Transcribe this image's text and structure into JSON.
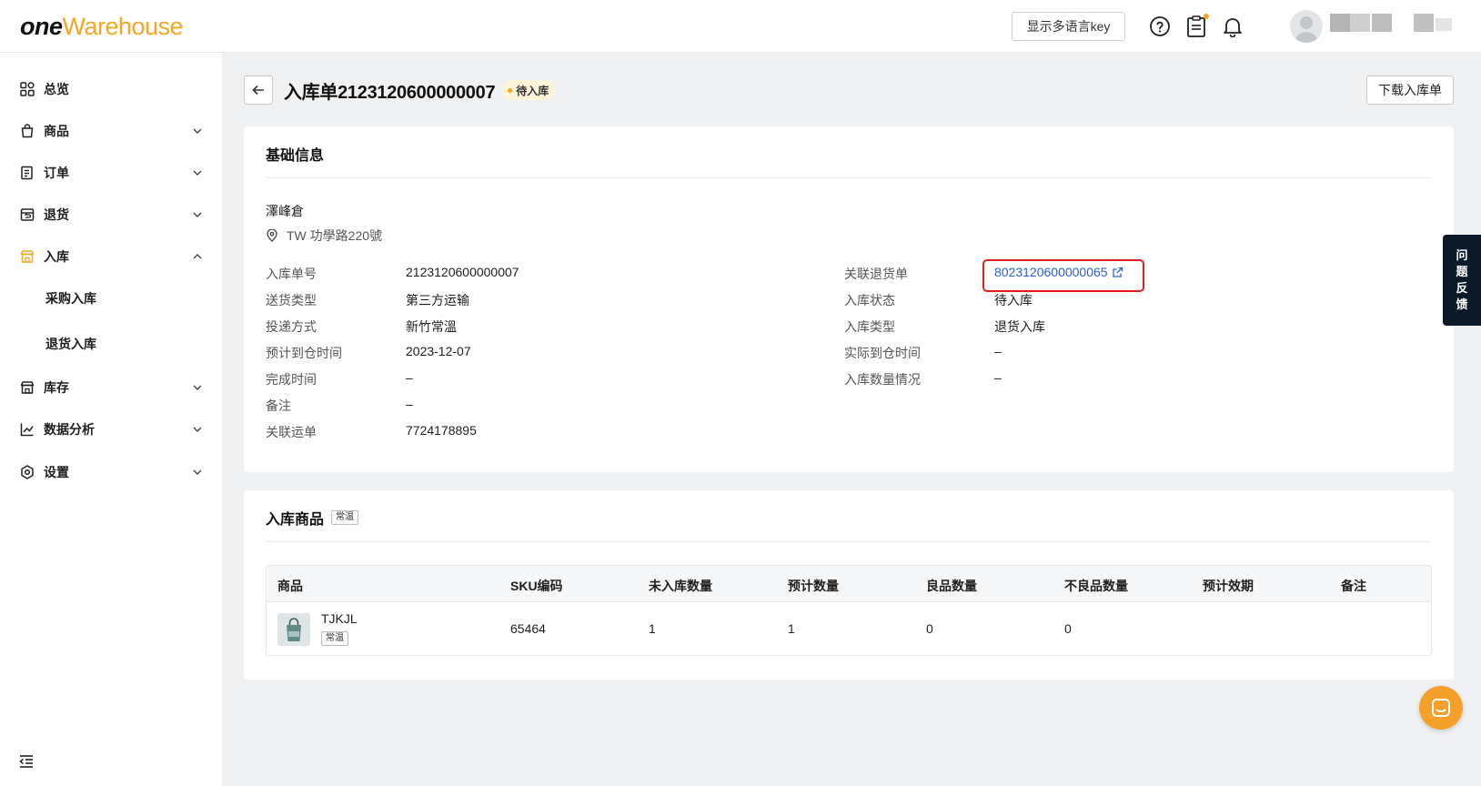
{
  "brand": {
    "part1": "one",
    "part2": "Warehouse"
  },
  "topbar": {
    "lang_button": "显示多语言key",
    "icons": [
      "help-icon",
      "clipboard-icon",
      "bell-icon"
    ]
  },
  "sidebar": {
    "items": [
      {
        "label": "总览",
        "icon": "dashboard-icon",
        "has_chevron": false
      },
      {
        "label": "商品",
        "icon": "bag-icon",
        "has_chevron": true
      },
      {
        "label": "订单",
        "icon": "order-icon",
        "has_chevron": true
      },
      {
        "label": "退货",
        "icon": "return-icon",
        "has_chevron": true
      },
      {
        "label": "入库",
        "icon": "inbound-icon",
        "has_chevron": true,
        "expanded": true
      },
      {
        "label": "库存",
        "icon": "store-icon",
        "has_chevron": true
      },
      {
        "label": "数据分析",
        "icon": "analytics-icon",
        "has_chevron": true
      },
      {
        "label": "设置",
        "icon": "settings-icon",
        "has_chevron": true
      }
    ],
    "sub_items": [
      "采购入库",
      "退货入库"
    ]
  },
  "page": {
    "title": "入库单2123120600000007",
    "status": "待入库",
    "download_button": "下载入库单"
  },
  "basic_info": {
    "title": "基础信息",
    "warehouse_name": "澤峰倉",
    "warehouse_address": "TW 功學路220號",
    "left": [
      {
        "label": "入库单号",
        "value": "2123120600000007"
      },
      {
        "label": "送货类型",
        "value": "第三方运输"
      },
      {
        "label": "投递方式",
        "value": "新竹常溫"
      },
      {
        "label": "预计到仓时间",
        "value": "2023-12-07"
      },
      {
        "label": "完成时间",
        "value": "–"
      },
      {
        "label": "备注",
        "value": "–"
      },
      {
        "label": "关联运单",
        "value": "7724178895"
      }
    ],
    "right": [
      {
        "label": "关联退货单",
        "value": "8023120600000065",
        "is_link": true
      },
      {
        "label": "入库状态",
        "value": "待入库"
      },
      {
        "label": "入库类型",
        "value": "退货入库"
      },
      {
        "label": "实际到仓时间",
        "value": "–"
      },
      {
        "label": "入库数量情况",
        "value": "–"
      }
    ]
  },
  "goods": {
    "title": "入库商品",
    "temp_tag": "常温",
    "columns": [
      "商品",
      "SKU编码",
      "未入库数量",
      "预计数量",
      "良品数量",
      "不良品数量",
      "预计效期",
      "备注"
    ],
    "rows": [
      {
        "name": "TJKJL",
        "tag": "常温",
        "sku": "65464",
        "not_received": "1",
        "expected": "1",
        "good": "0",
        "defective": "0",
        "expiry": "",
        "remark": ""
      }
    ]
  },
  "feedback": {
    "chars": [
      "问",
      "题",
      "反",
      "馈"
    ]
  },
  "colors": {
    "accent": "#f5a623",
    "link": "#2b5fd9",
    "highlight": "#e02020",
    "feedback_bg": "#0c1929"
  }
}
